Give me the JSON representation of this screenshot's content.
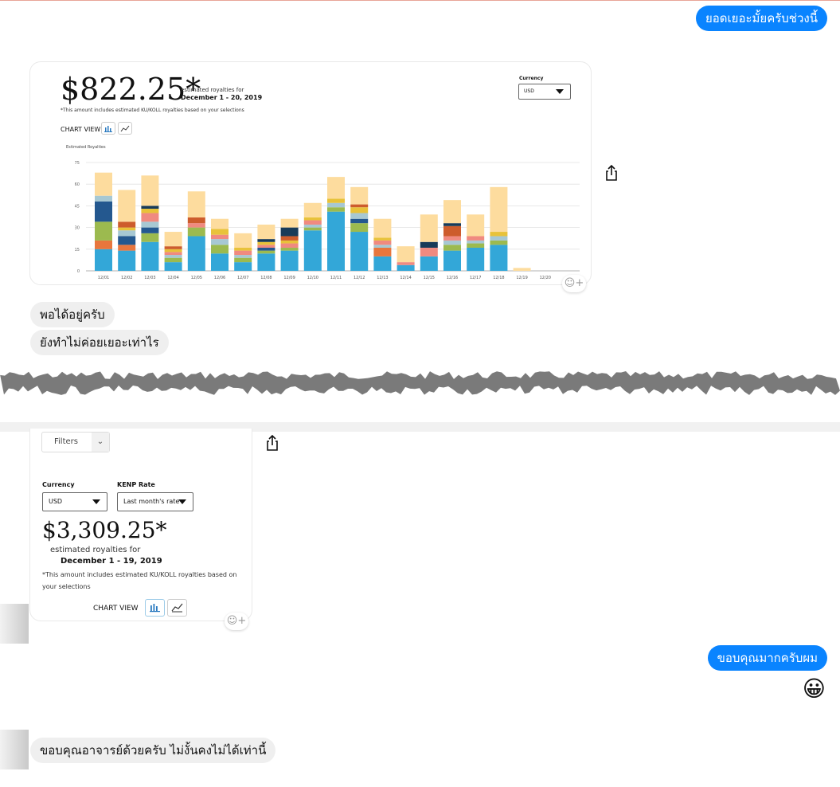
{
  "messages": {
    "out1": "ยอดเยอะมั้ยครับช่วงนี้",
    "in1": "พอได้อยู่ครับ",
    "in2": "ยังทำไม่ค่อยเยอะเท่าไร",
    "out2": "ขอบคุณมากครับผม",
    "out2_emoji": "😀",
    "in3": "ขอบคุณอาจารย์ด้วยครับ ไม่งั้นคงไม่ได้เท่านี้"
  },
  "card1": {
    "amount": "$822.25*",
    "estimated_label": "estimated royalties for",
    "date_range": "December 1 - 20, 2019",
    "footnote": "*This amount includes estimated KU/KOLL royalties based on your selections",
    "currency_label": "Currency",
    "currency_value": "USD",
    "chart_view_label": "CHART VIEW",
    "chart_ylabel": "Estimated Royalties"
  },
  "card2": {
    "filters_label": "Filters",
    "currency_label": "Currency",
    "currency_value": "USD",
    "kenp_label": "KENP Rate",
    "kenp_value": "Last month's rate",
    "amount": "$3,309.25*",
    "estimated_label": "estimated royalties for",
    "date_range": "December 1 - 19, 2019",
    "footnote": "*This amount includes estimated KU/KOLL royalties based on your selections",
    "chart_view_label": "CHART VIEW"
  },
  "icons": {
    "share": "share-icon",
    "reaction": "add-reaction-icon",
    "bar_view": "bar-chart-icon",
    "line_view": "line-chart-icon",
    "dropdown": "chevron-down-icon"
  },
  "colors": {
    "bubble_outgoing": "#0a84ff",
    "bubble_incoming": "#efefef",
    "bar_base": "#33a7d8",
    "bar_top": "#fddc9e"
  },
  "chart_data": {
    "type": "bar",
    "stacked": true,
    "title": "",
    "ylabel": "Estimated Royalties",
    "xlabel": "",
    "ylim": [
      0,
      75
    ],
    "yticks": [
      "0",
      "15",
      "30",
      "45",
      "60",
      "75"
    ],
    "grid": true,
    "categories": [
      "12/01",
      "12/02",
      "12/03",
      "12/04",
      "12/05",
      "12/06",
      "12/07",
      "12/08",
      "12/09",
      "12/10",
      "12/11",
      "12/12",
      "12/13",
      "12/14",
      "12/15",
      "12/16",
      "12/17",
      "12/18",
      "12/19",
      "12/20"
    ],
    "totals": [
      68,
      56,
      66,
      27,
      55,
      36,
      26,
      32,
      36,
      47,
      65,
      58,
      36,
      17,
      39,
      49,
      39,
      58,
      2,
      0
    ],
    "series": [
      {
        "color": "#33a7d8",
        "values": [
          15,
          14,
          20,
          6,
          24,
          12,
          6,
          12,
          14,
          28,
          41,
          27,
          10,
          4,
          10,
          14,
          16,
          18,
          0,
          0
        ]
      },
      {
        "color": "#e8763d",
        "values": [
          6,
          4,
          0,
          0,
          0,
          0,
          0,
          0,
          0,
          0,
          0,
          0,
          6,
          0,
          0,
          0,
          0,
          0,
          0,
          0
        ]
      },
      {
        "color": "#9cba4f",
        "values": [
          13,
          0,
          6,
          3,
          6,
          6,
          3,
          2,
          2,
          2,
          3,
          6,
          0,
          0,
          0,
          4,
          3,
          3,
          0,
          0
        ]
      },
      {
        "color": "#24588f",
        "values": [
          14,
          6,
          4,
          0,
          0,
          0,
          0,
          2,
          0,
          0,
          0,
          3,
          0,
          0,
          0,
          0,
          0,
          0,
          0,
          0
        ]
      },
      {
        "color": "#a7c8d3",
        "values": [
          4,
          4,
          4,
          2,
          0,
          4,
          2,
          0,
          0,
          2,
          3,
          4,
          2,
          0,
          0,
          3,
          2,
          3,
          0,
          0
        ]
      },
      {
        "color": "#f08a80",
        "values": [
          0,
          0,
          6,
          2,
          3,
          3,
          3,
          2,
          3,
          3,
          0,
          0,
          3,
          2,
          6,
          3,
          3,
          0,
          0,
          0
        ]
      },
      {
        "color": "#e8c23a",
        "values": [
          0,
          2,
          3,
          2,
          0,
          4,
          2,
          2,
          2,
          2,
          3,
          4,
          2,
          0,
          0,
          0,
          0,
          3,
          0,
          0
        ]
      },
      {
        "color": "#cd5c2c",
        "values": [
          0,
          4,
          0,
          2,
          4,
          0,
          0,
          0,
          3,
          0,
          0,
          2,
          0,
          0,
          0,
          7,
          0,
          0,
          0,
          0
        ]
      },
      {
        "color": "#183b59",
        "values": [
          0,
          0,
          2,
          0,
          0,
          0,
          0,
          2,
          6,
          0,
          0,
          0,
          0,
          0,
          4,
          2,
          0,
          0,
          0,
          0
        ]
      },
      {
        "color": "#fddc9e",
        "values": [
          16,
          22,
          21,
          10,
          18,
          7,
          10,
          10,
          6,
          10,
          15,
          12,
          13,
          11,
          19,
          16,
          15,
          31,
          2,
          0
        ]
      }
    ]
  }
}
